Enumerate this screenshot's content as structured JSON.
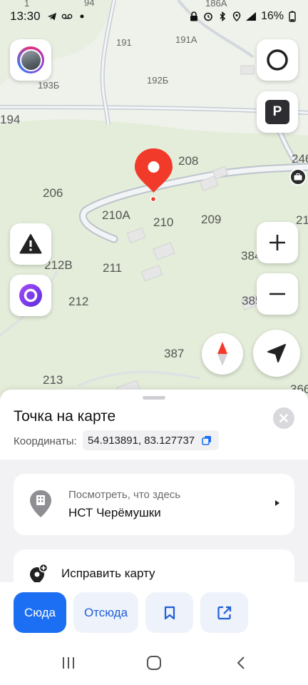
{
  "status_bar": {
    "time": "13:30",
    "battery": "16%",
    "left_icons": [
      "telegram-icon",
      "voicemail-icon",
      "dot-icon"
    ],
    "right_icons": [
      "lock-icon",
      "alarm-icon",
      "bluetooth-icon",
      "location-icon",
      "signal-icon"
    ]
  },
  "map": {
    "house_numbers": [
      "94",
      "191",
      "191А",
      "193Б",
      "192Б",
      "194",
      "208",
      "206",
      "210А",
      "210",
      "209",
      "212В",
      "211",
      "212",
      "387",
      "213",
      "384",
      "385",
      "246",
      "21",
      "366",
      "186А",
      "1"
    ],
    "controls": [
      "profile-avatar",
      "alice-ring",
      "parking",
      "alert",
      "alice-assistant",
      "zoom-in",
      "zoom-out",
      "compass",
      "my-location"
    ]
  },
  "sheet": {
    "title": "Точка на карте",
    "coords_label": "Координаты:",
    "coords_value": "54.913891, 83.127737",
    "here_card": {
      "subtitle": "Посмотреть, что здесь",
      "place": "НСТ Черёмушки"
    },
    "fix_card": {
      "label": "Исправить карту"
    },
    "actions": {
      "to_here": "Сюда",
      "from_here": "Отсюда"
    }
  },
  "colors": {
    "accent": "#1c6ff2",
    "pin": "#f23a2a",
    "alice": "#7b3ff2",
    "map_bg": "#eef2ea"
  }
}
